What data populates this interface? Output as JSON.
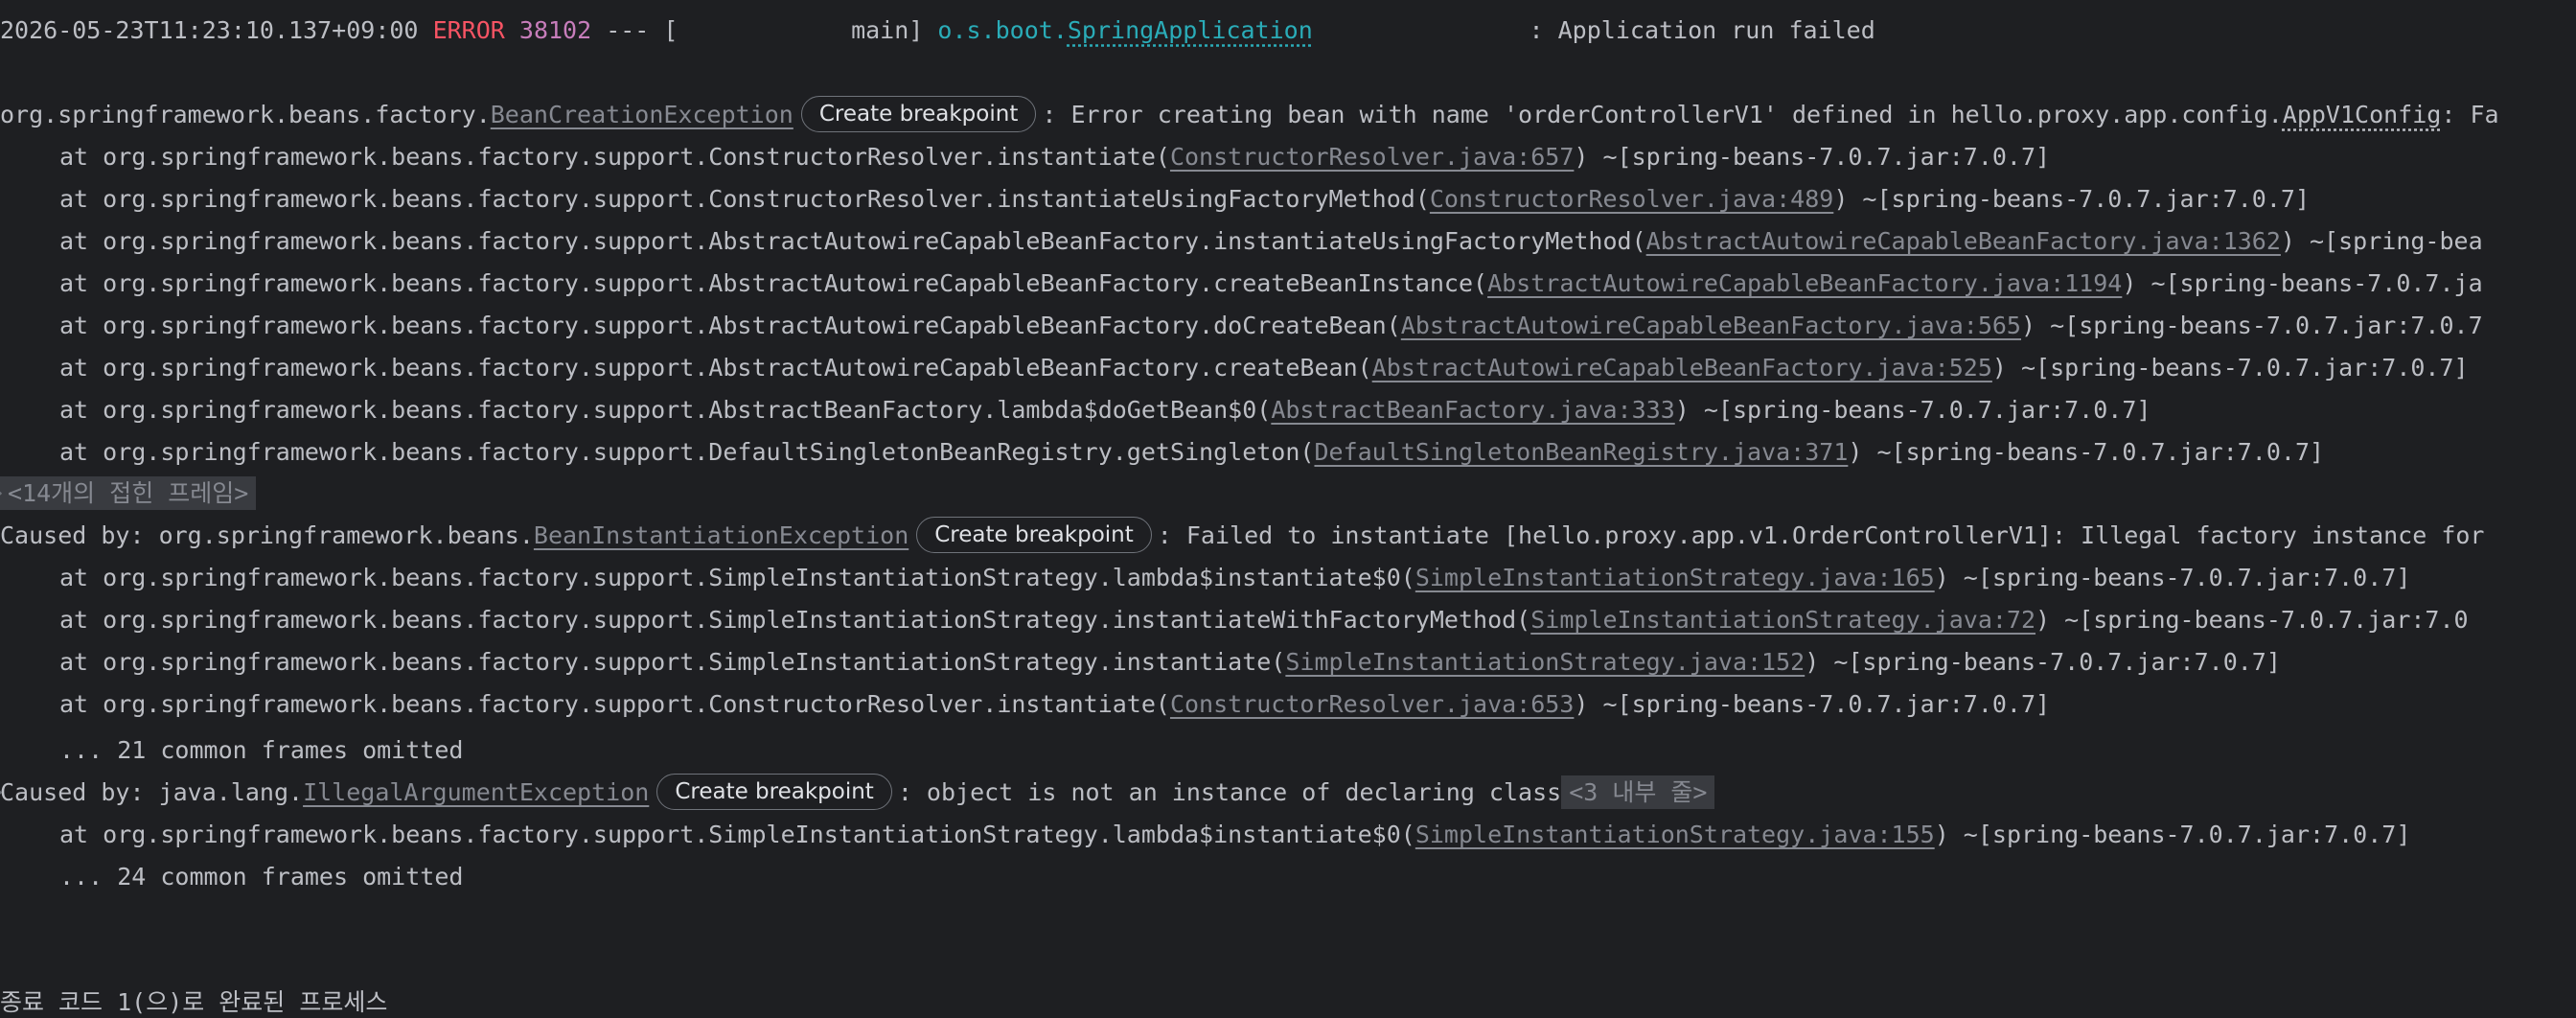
{
  "header": {
    "timestamp": "2026-05-23T11:23:10.137+09:00",
    "level": "ERROR",
    "pid": "38102",
    "sep": " --- [",
    "thread": "            main] ",
    "logger_prefix": "o.s.boot.",
    "logger_name": "SpringApplication",
    "pad": "               ",
    "message": ": Application run failed"
  },
  "exc1": {
    "prefix": "org.springframework.beans.factory.",
    "cls": "BeanCreationException",
    "bp": "Create breakpoint",
    "msg": ": Error creating bean with name 'orderControllerV1' defined in hello.proxy.app.config.",
    "msg_link": "AppV1Config",
    "msg_tail": ": Fa",
    "frames": [
      {
        "pre": "at org.springframework.beans.factory.support.ConstructorResolver.instantiate(",
        "link": "ConstructorResolver.java:657",
        "post": ") ~[spring-beans-7.0.7.jar:7.0.7]"
      },
      {
        "pre": "at org.springframework.beans.factory.support.ConstructorResolver.instantiateUsingFactoryMethod(",
        "link": "ConstructorResolver.java:489",
        "post": ") ~[spring-beans-7.0.7.jar:7.0.7]"
      },
      {
        "pre": "at org.springframework.beans.factory.support.AbstractAutowireCapableBeanFactory.instantiateUsingFactoryMethod(",
        "link": "AbstractAutowireCapableBeanFactory.java:1362",
        "post": ") ~[spring-bea"
      },
      {
        "pre": "at org.springframework.beans.factory.support.AbstractAutowireCapableBeanFactory.createBeanInstance(",
        "link": "AbstractAutowireCapableBeanFactory.java:1194",
        "post": ") ~[spring-beans-7.0.7.ja"
      },
      {
        "pre": "at org.springframework.beans.factory.support.AbstractAutowireCapableBeanFactory.doCreateBean(",
        "link": "AbstractAutowireCapableBeanFactory.java:565",
        "post": ") ~[spring-beans-7.0.7.jar:7.0.7"
      },
      {
        "pre": "at org.springframework.beans.factory.support.AbstractAutowireCapableBeanFactory.createBean(",
        "link": "AbstractAutowireCapableBeanFactory.java:525",
        "post": ") ~[spring-beans-7.0.7.jar:7.0.7]"
      },
      {
        "pre": "at org.springframework.beans.factory.support.AbstractBeanFactory.lambda$doGetBean$0(",
        "link": "AbstractBeanFactory.java:333",
        "post": ") ~[spring-beans-7.0.7.jar:7.0.7]"
      },
      {
        "pre": "at org.springframework.beans.factory.support.DefaultSingletonBeanRegistry.getSingleton(",
        "link": "DefaultSingletonBeanRegistry.java:371",
        "post": ") ~[spring-beans-7.0.7.jar:7.0.7]"
      }
    ],
    "folded": "<14개의 접힌 프레임>"
  },
  "exc2": {
    "prefix": "Caused by: org.springframework.beans.",
    "cls": "BeanInstantiationException",
    "bp": "Create breakpoint",
    "msg": ": Failed to instantiate [hello.proxy.app.v1.OrderControllerV1]: Illegal factory instance for",
    "frames": [
      {
        "pre": "at org.springframework.beans.factory.support.SimpleInstantiationStrategy.lambda$instantiate$0(",
        "link": "SimpleInstantiationStrategy.java:165",
        "post": ") ~[spring-beans-7.0.7.jar:7.0.7]"
      },
      {
        "pre": "at org.springframework.beans.factory.support.SimpleInstantiationStrategy.instantiateWithFactoryMethod(",
        "link": "SimpleInstantiationStrategy.java:72",
        "post": ") ~[spring-beans-7.0.7.jar:7.0"
      },
      {
        "pre": "at org.springframework.beans.factory.support.SimpleInstantiationStrategy.instantiate(",
        "link": "SimpleInstantiationStrategy.java:152",
        "post": ") ~[spring-beans-7.0.7.jar:7.0.7]"
      },
      {
        "pre": "at org.springframework.beans.factory.support.ConstructorResolver.instantiate(",
        "link": "ConstructorResolver.java:653",
        "post": ") ~[spring-beans-7.0.7.jar:7.0.7]"
      }
    ],
    "omitted": "... 21 common frames omitted"
  },
  "exc3": {
    "prefix": "Caused by: java.lang.",
    "cls": "IllegalArgumentException",
    "bp": "Create breakpoint",
    "msg": ": object is not an instance of declaring class",
    "internal": "<3 내부 줄>",
    "frame": {
      "pre": "at org.springframework.beans.factory.support.SimpleInstantiationStrategy.lambda$instantiate$0(",
      "link": "SimpleInstantiationStrategy.java:155",
      "post": ") ~[spring-beans-7.0.7.jar:7.0.7]"
    },
    "omitted": "... 24 common frames omitted"
  },
  "footer": {
    "exit_message": "종료 코드 1(으)로 완료된 프로세스"
  }
}
